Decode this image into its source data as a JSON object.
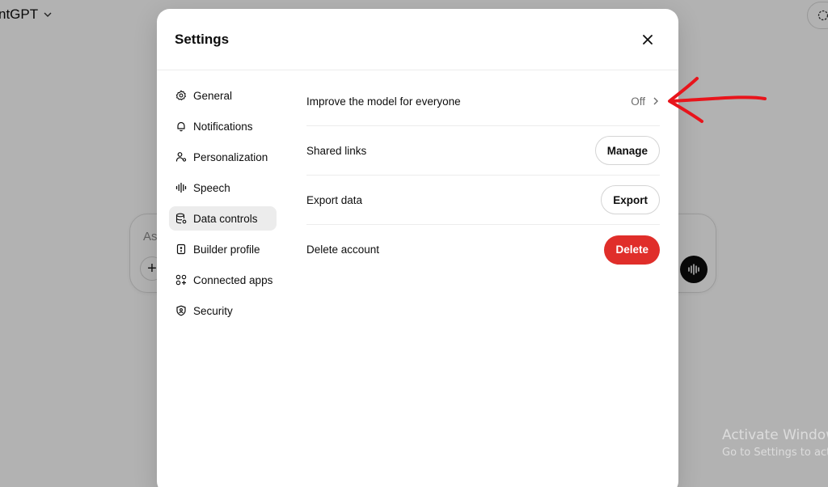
{
  "app": {
    "title": "ntGPT",
    "composer_placeholder": "As"
  },
  "settings": {
    "title": "Settings",
    "close_icon": "close-icon",
    "sidebar": {
      "items": [
        {
          "label": "General",
          "icon": "gear-icon",
          "active": false
        },
        {
          "label": "Notifications",
          "icon": "bell-icon",
          "active": false
        },
        {
          "label": "Personalization",
          "icon": "person-icon",
          "active": false
        },
        {
          "label": "Speech",
          "icon": "waveform-icon",
          "active": false
        },
        {
          "label": "Data controls",
          "icon": "database-icon",
          "active": true
        },
        {
          "label": "Builder profile",
          "icon": "id-card-icon",
          "active": false
        },
        {
          "label": "Connected apps",
          "icon": "apps-grid-icon",
          "active": false
        },
        {
          "label": "Security",
          "icon": "shield-icon",
          "active": false
        }
      ]
    },
    "rows": {
      "improve": {
        "label": "Improve the model for everyone",
        "value": "Off"
      },
      "shared_links": {
        "label": "Shared links",
        "button": "Manage"
      },
      "export": {
        "label": "Export data",
        "button": "Export"
      },
      "delete": {
        "label": "Delete account",
        "button": "Delete"
      }
    }
  },
  "watermark": {
    "line1": "Activate Window",
    "line2": "Go to Settings to act"
  },
  "colors": {
    "danger": "#e02e2a",
    "annotation_arrow": "#e8141b",
    "active_item_bg": "#ececec",
    "overlay": "rgba(0,0,0,0.30)"
  }
}
